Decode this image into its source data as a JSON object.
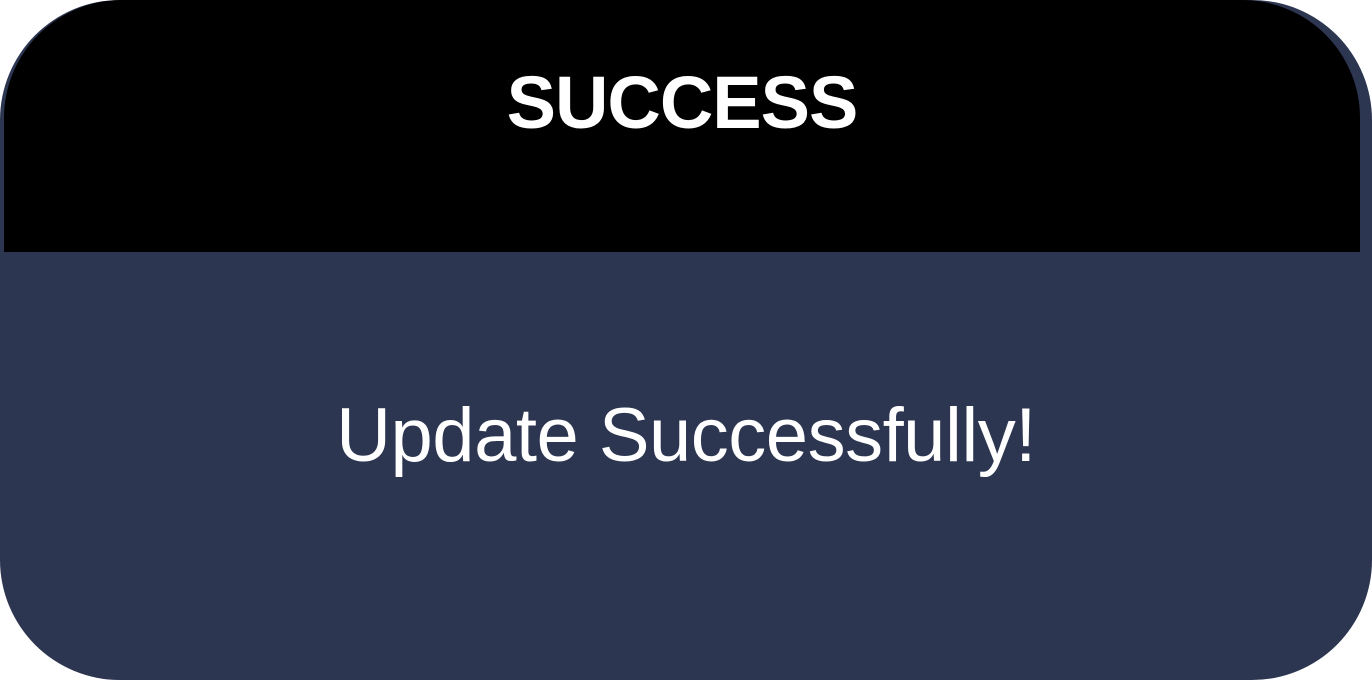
{
  "dialog": {
    "title": "SUCCESS",
    "message": "Update Successfully!"
  },
  "colors": {
    "header_background": "#000000",
    "body_background": "#2d3651",
    "text": "#ffffff"
  }
}
